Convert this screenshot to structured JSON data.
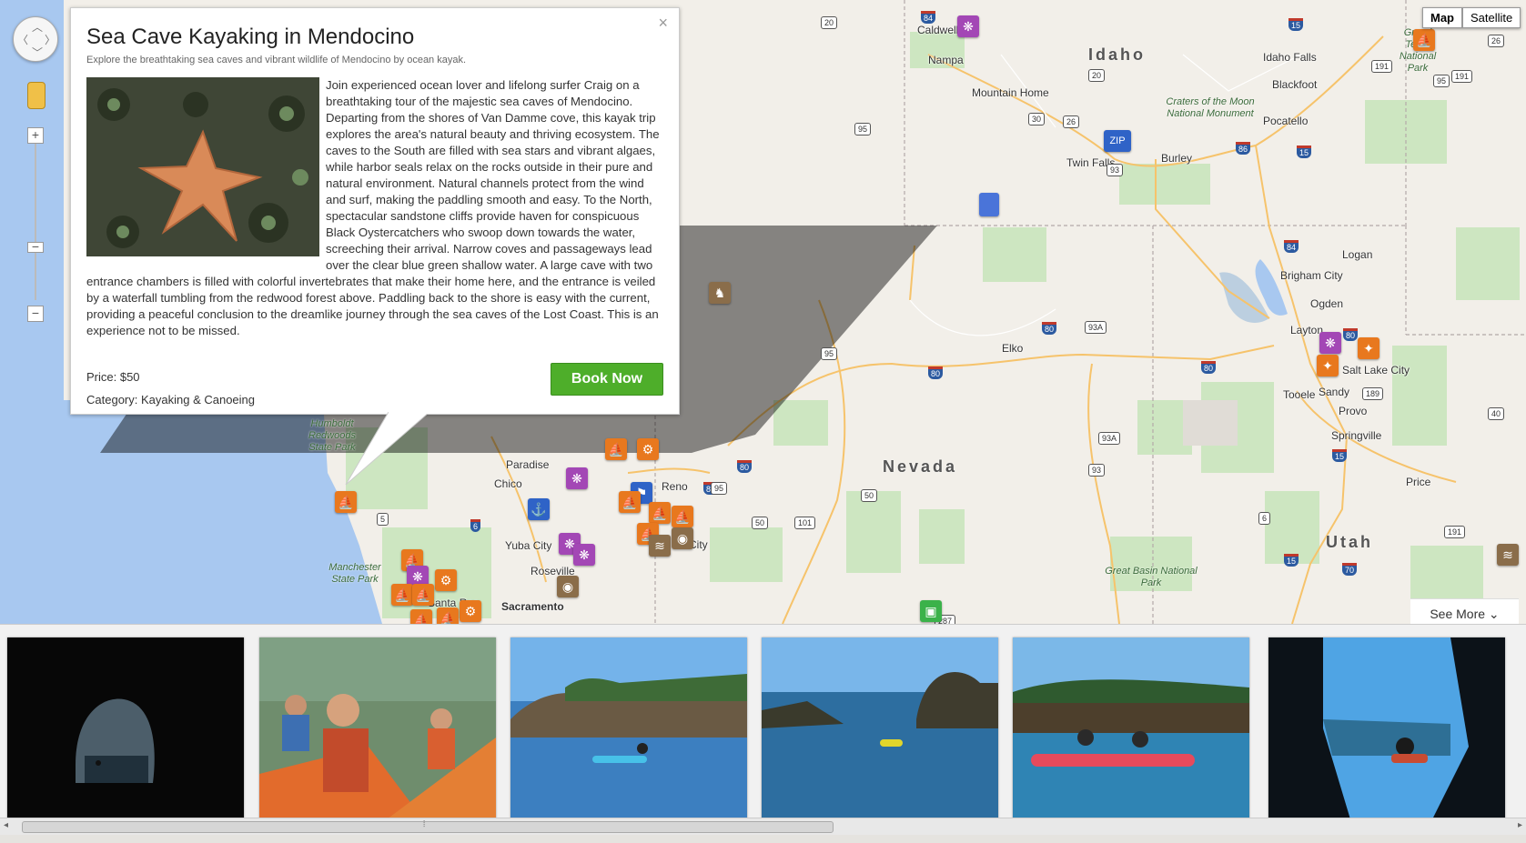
{
  "map": {
    "map_type": {
      "map": "Map",
      "satellite": "Satellite",
      "active": "Map"
    },
    "states": [
      "Idaho",
      "Nevada",
      "Utah"
    ],
    "places": [
      "Caldwell",
      "Nampa",
      "Mountain Home",
      "Idaho Falls",
      "Blackfoot",
      "Pocatello",
      "Twin Falls",
      "Burley",
      "Logan",
      "Brigham City",
      "Ogden",
      "Layton",
      "Salt Lake City",
      "Sandy",
      "Tooele",
      "Provo",
      "Springville",
      "Price",
      "Elko",
      "Reno",
      "Paradise",
      "Chico",
      "Yuba City",
      "Roseville",
      "Sacramento",
      "Santa Ros",
      "City"
    ],
    "parks": [
      "Craters of the Moon National Monument",
      "Great Basin National Park",
      "Humboldt Redwoods State Park",
      "Manchester State Park",
      "Grand Teton National Park"
    ],
    "highways": [
      "84",
      "20",
      "20",
      "15",
      "95",
      "30",
      "26",
      "93",
      "86",
      "15",
      "84",
      "80",
      "93A",
      "80",
      "80",
      "95",
      "80",
      "189",
      "15",
      "40",
      "93A",
      "93",
      "50",
      "6",
      "191",
      "191",
      "15",
      "70",
      "80",
      "80B",
      "95",
      "50",
      "101",
      "5",
      "6",
      "287",
      "26",
      "191",
      "95"
    ]
  },
  "info_window": {
    "title": "Sea Cave Kayaking in Mendocino",
    "subtitle": "Explore the breathtaking sea caves and vibrant wildlife of Mendocino by ocean kayak.",
    "description": "Join experienced ocean lover and lifelong surfer Craig on a breathtaking tour of the majestic sea caves of Mendocino. Departing from the shores of Van Damme cove, this kayak trip explores the area's natural beauty and thriving ecosystem. The caves to the South are filled with sea stars and vibrant algaes, while harbor seals relax on the rocks outside in their pure and natural environment. Natural channels protect from the wind and surf, making the paddling smooth and easy. To the North, spectacular sandstone cliffs provide haven for conspicuous Black Oystercatchers who swoop down towards the water, screeching their arrival. Narrow coves and passageways lead over the clear blue green shallow water. A large cave with two entrance chambers is filled with colorful invertebrates that make their home here, and the entrance is veiled by a waterfall tumbling from the redwood forest above. Paddling back to the shore is easy with the current, providing a peaceful conclusion to the dreamlike journey through the sea caves of the Lost Coast. This is an experience not to be missed.",
    "price": "Price: $50",
    "category": "Category: Kayaking & Canoeing",
    "book_label": "Book Now",
    "close": "×"
  },
  "see_more": "See More",
  "colors": {
    "book": "#4eae2a",
    "orange_pin": "#e8781e",
    "purple_pin": "#a347b5",
    "brown_pin": "#8a6d4a",
    "blue_pin": "#2f63c7"
  },
  "gallery": {
    "thumbnails": [
      "sea-cave-arch",
      "kayakers-smiling",
      "coastal-cliffs-kayak",
      "kayakers-bay",
      "red-tandem-kayak",
      "kayak-in-cave"
    ]
  },
  "pin_icons": {
    "zip": "ZIP"
  }
}
